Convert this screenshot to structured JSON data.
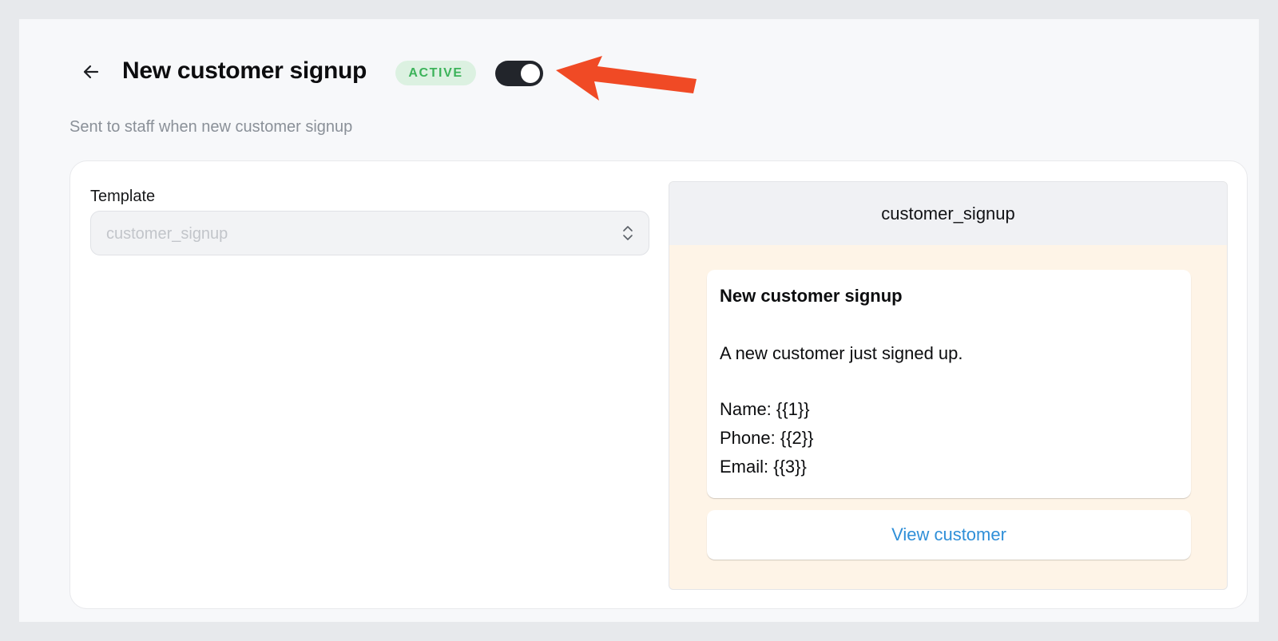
{
  "header": {
    "title": "New customer signup",
    "status": "ACTIVE",
    "toggle_on": true,
    "description": "Sent to staff when new customer signup"
  },
  "form": {
    "template_label": "Template",
    "template_value": "customer_signup"
  },
  "preview": {
    "template_name": "customer_signup",
    "message": {
      "title": "New customer signup",
      "body": "A new customer just signed up.",
      "name_line": "Name: {{1}}",
      "phone_line": "Phone: {{2}}",
      "email_line": "Email: {{3}}"
    },
    "button_label": "View customer"
  },
  "colors": {
    "accent_link": "#2f8fd8",
    "active_badge_bg": "#dcf1e1",
    "active_badge_text": "#3cb35a",
    "toggle_on": "#22252b",
    "annotation_arrow": "#f04a25",
    "preview_background": "#fef4e7"
  },
  "icons": {
    "back": "arrow-left-icon",
    "select": "chevron-up-down-icon",
    "annotation": "red-arrow"
  }
}
